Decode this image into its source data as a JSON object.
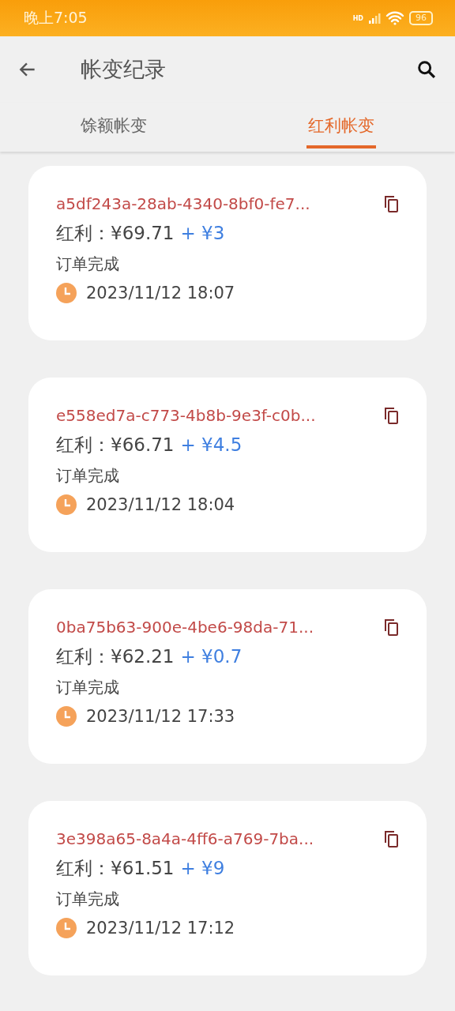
{
  "status_bar": {
    "time": "晚上7:05",
    "network": "HD",
    "battery": "96"
  },
  "app_bar": {
    "title": "帐变纪录"
  },
  "tabs": [
    {
      "label": "馀额帐变",
      "selected": false
    },
    {
      "label": "红利帐变",
      "selected": true
    }
  ],
  "records": [
    {
      "id": "a5df243a-28ab-4340-8bf0-fe7...",
      "label": "红利：",
      "amount": "¥69.71",
      "bonus": "+ ¥3",
      "status": "订单完成",
      "time": "2023/11/12 18:07"
    },
    {
      "id": "e558ed7a-c773-4b8b-9e3f-c0b...",
      "label": "红利：",
      "amount": "¥66.71",
      "bonus": "+ ¥4.5",
      "status": "订单完成",
      "time": "2023/11/12 18:04"
    },
    {
      "id": "0ba75b63-900e-4be6-98da-71...",
      "label": "红利：",
      "amount": "¥62.21",
      "bonus": "+ ¥0.7",
      "status": "订单完成",
      "time": "2023/11/12 17:33"
    },
    {
      "id": "3e398a65-8a4a-4ff6-a769-7ba...",
      "label": "红利：",
      "amount": "¥61.51",
      "bonus": "+ ¥9",
      "status": "订单完成",
      "time": "2023/11/12 17:12"
    }
  ]
}
